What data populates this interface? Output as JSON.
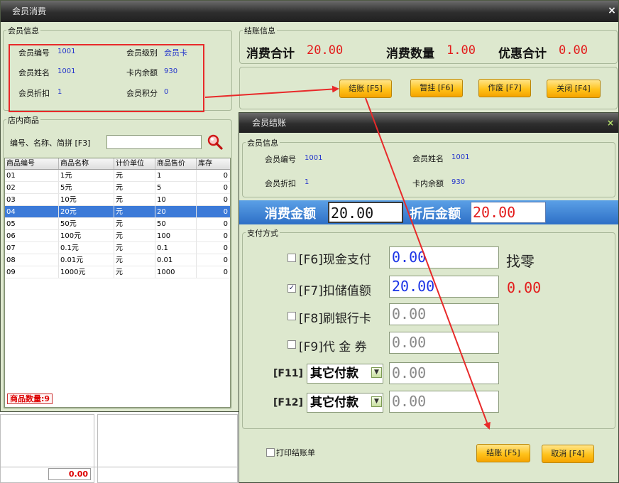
{
  "main": {
    "title": "会员消费",
    "close_glyph": "×",
    "member_info": {
      "title": "会员信息",
      "labels": {
        "no": "会员编号",
        "level": "会员级别",
        "name": "会员姓名",
        "balance": "卡内余额",
        "discount": "会员折扣",
        "points": "会员积分"
      },
      "values": {
        "no": "1001",
        "level": "会员卡",
        "name": "1001",
        "balance": "930",
        "discount": "1",
        "points": "0"
      }
    },
    "checkout_info": {
      "title": "结账信息",
      "total_label": "消费合计",
      "total": "20.00",
      "qty_label": "消费数量",
      "qty": "1.00",
      "discount_label": "优惠合计",
      "discount": "0.00"
    },
    "buttons": {
      "checkout": "结账 [F5]",
      "hold": "暂挂 [F6]",
      "void": "作废 [F7]",
      "close": "关闭 [F4]"
    },
    "products": {
      "title": "店内商品",
      "search_label": "编号、名称、简拼 [F3]",
      "search_value": "",
      "columns": [
        "商品编号",
        "商品名称",
        "计价单位",
        "商品售价",
        "库存"
      ],
      "rows": [
        [
          "01",
          "1元",
          "元",
          "1",
          "0"
        ],
        [
          "02",
          "5元",
          "元",
          "5",
          "0"
        ],
        [
          "03",
          "10元",
          "元",
          "10",
          "0"
        ],
        [
          "04",
          "20元",
          "元",
          "20",
          "0"
        ],
        [
          "05",
          "50元",
          "元",
          "50",
          "0"
        ],
        [
          "06",
          "100元",
          "元",
          "100",
          "0"
        ],
        [
          "07",
          "0.1元",
          "元",
          "0.1",
          "0"
        ],
        [
          "08",
          "0.01元",
          "元",
          "0.01",
          "0"
        ],
        [
          "09",
          "1000元",
          "元",
          "1000",
          "0"
        ]
      ],
      "selected_row": 3,
      "count_label": "商品数量:9"
    },
    "bottom_total": "0.00"
  },
  "dialog": {
    "title": "会员结账",
    "close_glyph": "×",
    "member_info": {
      "title": "会员信息",
      "labels": {
        "no": "会员编号",
        "name": "会员姓名",
        "discount": "会员折扣",
        "balance": "卡内余额"
      },
      "values": {
        "no": "1001",
        "name": "1001",
        "discount": "1",
        "balance": "930"
      }
    },
    "amount_label": "消费金额",
    "amount": "20.00",
    "after_label": "折后金额",
    "after": "20.00",
    "payment": {
      "title": "支付方式",
      "cash_label": "[F6]现金支付",
      "cash_value": "0.00",
      "cash_checked": false,
      "change_label": "找零",
      "change_value": "0.00",
      "stored_label": "[F7]扣储值额",
      "stored_value": "20.00",
      "stored_checked": true,
      "bank_label": "[F8]刷银行卡",
      "bank_value": "0.00",
      "bank_checked": false,
      "voucher_label": "[F9]代 金 券",
      "voucher_value": "0.00",
      "voucher_checked": false,
      "other1_key": "[F11]",
      "other1_select": "其它付款",
      "other1_value": "0.00",
      "other2_key": "[F12]",
      "other2_select": "其它付款",
      "other2_value": "0.00"
    },
    "print_label": "打印结账单",
    "print_checked": false,
    "buttons": {
      "checkout": "结账 [F5]",
      "cancel": "取消 [F4]"
    }
  },
  "colors": {
    "accent_red": "#e31b1b",
    "value_blue": "#1a33e6",
    "button_orange": "#ffc21a",
    "bar_blue": "#2d6fc6"
  }
}
